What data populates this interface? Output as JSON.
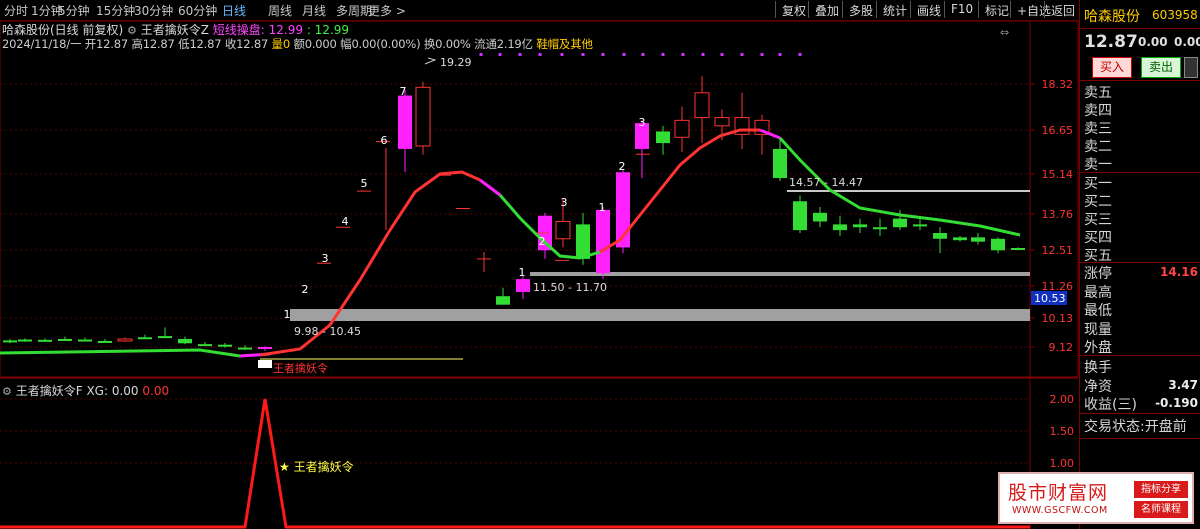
{
  "toolbar": {
    "periods": [
      "分时",
      "1分钟",
      "5分钟",
      "15分钟",
      "30分钟",
      "60分钟",
      "日线",
      "周线",
      "月线",
      "多周期",
      "更多 >"
    ],
    "active_period": "日线",
    "right_buttons": [
      "复权",
      "叠加",
      "多股",
      "统计",
      "画线",
      "F10",
      "标记",
      "+自选",
      "返回"
    ]
  },
  "chart": {
    "title_line": "哈森股份(日线 前复权)",
    "indicator_name": "王者擒妖令Z",
    "indicator_label": "短线操盘: 12.99",
    "indicator_value": ": 12.99",
    "info_date": "2024/11/18/一",
    "info_open": "开12.87",
    "info_high": "高12.87",
    "info_low": "低12.87",
    "info_close": "收12.87",
    "info_vol": "量0",
    "info_amount": "额0.000",
    "info_range": "幅0.00(0.00%)",
    "info_turn": "换0.00%",
    "info_float": "流通2.19亿",
    "info_sector": "鞋帽及其他",
    "price_axis": [
      "18.32",
      "16.65",
      "15.14",
      "13.76",
      "12.51",
      "11.26",
      "10.13",
      "9.12"
    ],
    "current_price_tag": "10.53",
    "high_label": "19.29",
    "zone_upper_label": "14.57 - 14.47",
    "zone_mid_label": "11.50 - 11.70",
    "zone_low_label": "9.98 - 10.45",
    "bottom_text": "王者擒妖令",
    "numbers": [
      "1",
      "2",
      "3",
      "4",
      "5",
      "6",
      "7",
      "1",
      "2",
      "3",
      "1",
      "2",
      "3"
    ]
  },
  "sub_chart": {
    "title": "王者擒妖令F",
    "xg_label": "XG: 0.00",
    "second_value": "0.00",
    "axis": [
      "2.00",
      "1.50",
      "1.00"
    ],
    "annotation": "★ 王者擒妖令"
  },
  "right_panel": {
    "name": "哈森股份",
    "code": "603958",
    "price": "12.87",
    "change": "0.00",
    "pct": "0.00%",
    "buy": "买入",
    "sell": "卖出",
    "sells": [
      "卖五",
      "卖四",
      "卖三",
      "卖二",
      "卖一"
    ],
    "buys": [
      "买一",
      "买二",
      "买三",
      "买四",
      "买五"
    ],
    "stats": [
      {
        "label": "涨停",
        "value": "14.16"
      },
      {
        "label": "最高",
        "value": ""
      },
      {
        "label": "最低",
        "value": ""
      },
      {
        "label": "现量",
        "value": ""
      },
      {
        "label": "外盘",
        "value": ""
      }
    ],
    "stats2": [
      {
        "label": "换手",
        "value": ""
      },
      {
        "label": "净资",
        "value": "3.47"
      },
      {
        "label": "收益(三)",
        "value": "-0.190"
      }
    ],
    "trade_status": "交易状态:开盘前"
  },
  "watermark": {
    "title": "股市财富网",
    "url": "WWW.GSCFW.COM",
    "tag1": "指标分享",
    "tag2": "名师课程"
  },
  "colors": {
    "up": "#ff3333",
    "down": "#33dd33",
    "magenta": "#ff22ff",
    "zone": "#a0a0a0",
    "accent": "#6bb8ff"
  }
}
